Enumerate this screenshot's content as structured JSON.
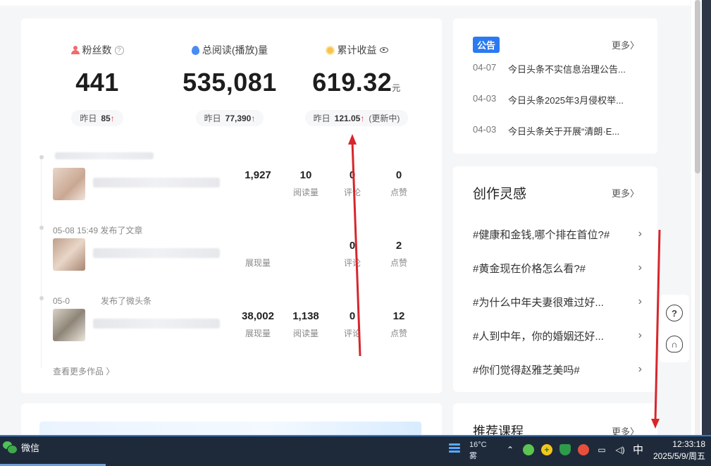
{
  "stats": {
    "fans": {
      "label": "粉丝数",
      "value": "441",
      "yesterday_label": "昨日",
      "yesterday_value": "85"
    },
    "reads": {
      "label": "总阅读(播放)量",
      "value": "535,081",
      "yesterday_label": "昨日",
      "yesterday_value": "77,390"
    },
    "income": {
      "label": "累计收益",
      "value": "619.32",
      "unit": "元",
      "yesterday_label": "昨日",
      "yesterday_value": "121.05",
      "status": "(更新中)"
    },
    "up_arrow": "↑"
  },
  "feed": [
    {
      "meta": "",
      "metrics": [
        {
          "value": "1,927",
          "label": ""
        },
        {
          "value": "10",
          "label": "阅读量"
        },
        {
          "value": "0",
          "label": "评论"
        },
        {
          "value": "0",
          "label": "点赞"
        }
      ]
    },
    {
      "meta": "05-08 15:49  发布了文章",
      "metrics": [
        {
          "value": "",
          "label": "展现量"
        },
        {
          "value": "",
          "label": ""
        },
        {
          "value": "0",
          "label": "评论"
        },
        {
          "value": "2",
          "label": "点赞"
        }
      ]
    },
    {
      "meta": "05-0",
      "meta_tail": "发布了微头条",
      "metrics": [
        {
          "value": "38,002",
          "label": "展现量"
        },
        {
          "value": "1,138",
          "label": "阅读量"
        },
        {
          "value": "0",
          "label": "评论"
        },
        {
          "value": "12",
          "label": "点赞"
        }
      ]
    }
  ],
  "more_works": "查看更多作品 〉",
  "notice": {
    "tag": "公告",
    "more": "更多〉",
    "items": [
      {
        "date": "04-07",
        "text": "今日头条不实信息治理公告..."
      },
      {
        "date": "04-03",
        "text": "今日头条2025年3月侵权举..."
      },
      {
        "date": "04-03",
        "text": "今日头条关于开展“清朗·E..."
      }
    ]
  },
  "inspiration": {
    "title": "创作灵感",
    "more": "更多〉",
    "items": [
      "#健康和金钱,哪个排在首位?#",
      "#黄金现在价格怎么看?#",
      "#为什么中年夫妻很难过好...",
      "#人到中年，你的婚姻还好...",
      "#你们觉得赵雅芝美吗#"
    ],
    "chevron": "›"
  },
  "courses": {
    "title": "推荐课程",
    "more": "更多〉"
  },
  "side_buttons": {
    "help": "?",
    "support": "∩"
  },
  "taskbar": {
    "app_label": "微信",
    "temp": "16°C",
    "weather": "雾",
    "ime": "中",
    "time": "12:33:18",
    "date": "2025/5/9/周五",
    "tray_caret": "⌃"
  },
  "colors": {
    "accent": "#2a7af1",
    "up": "#e4393c",
    "annotation": "#d7262b"
  }
}
